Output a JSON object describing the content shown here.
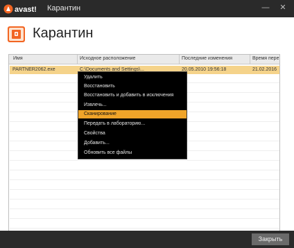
{
  "window": {
    "brand": "avast!",
    "title": "Карантин",
    "minimize": "—",
    "close": "✕"
  },
  "page": {
    "title": "Карантин"
  },
  "table": {
    "columns": [
      "Имя",
      "Исходное расположение",
      "Последние изменения",
      "Время пере"
    ],
    "rows": [
      {
        "name": "PARTNER2062.exe",
        "location": "C:\\Documents and Settings\\...",
        "modified": "20.05.2010 19:56:18",
        "time": "21.02.2016"
      }
    ]
  },
  "context_menu": {
    "items": [
      "Удалить",
      "Восстановить",
      "Восстановить и добавить в исключения",
      "Извлечь...",
      "Сканирование",
      "Передать в лабораторию...",
      "Свойства",
      "Добавить...",
      "Обновить все файлы"
    ],
    "selected": "Сканирование"
  },
  "footer": {
    "close_button": "Закрыть"
  },
  "colors": {
    "accent": "#f0a429",
    "selected_row": "#f5d38a",
    "titlebar": "#2a2a2a",
    "brand_orange": "#f26522"
  }
}
